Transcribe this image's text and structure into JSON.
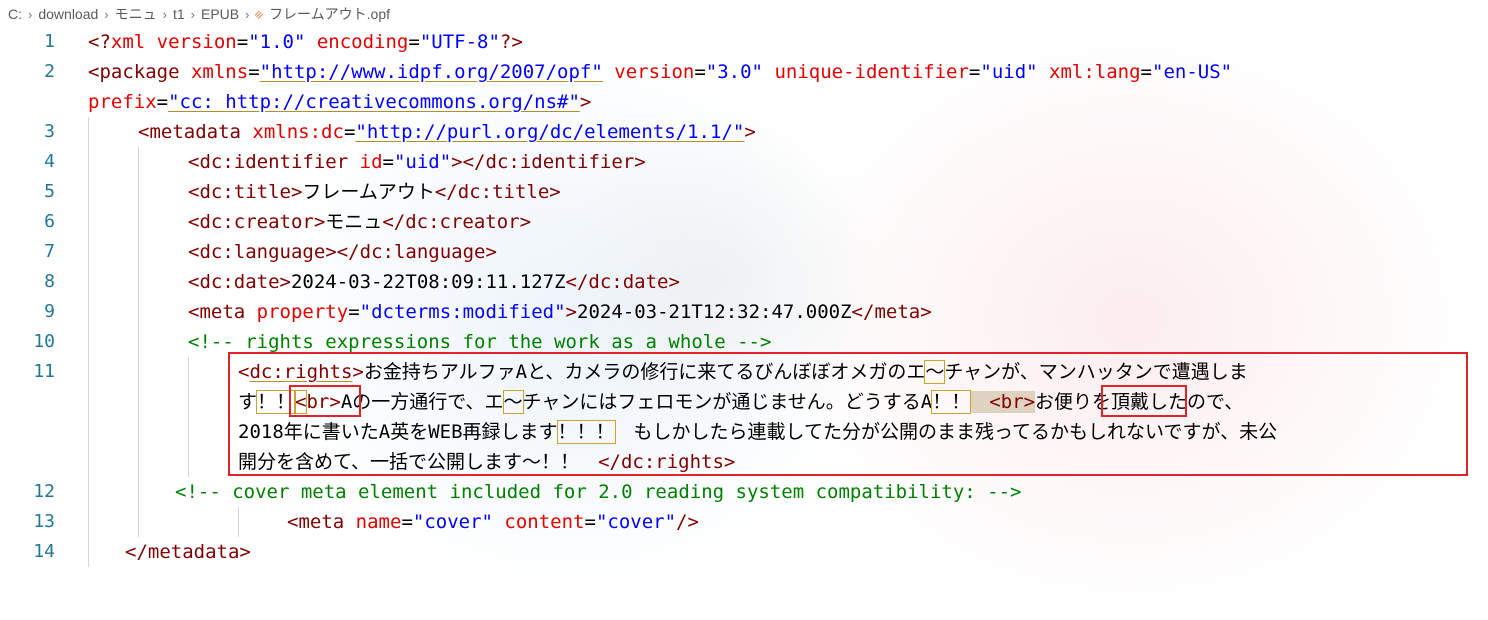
{
  "breadcrumb": {
    "items": [
      "C:",
      "download",
      "モニュ",
      "t1",
      "EPUB"
    ],
    "file": "フレームアウト.opf"
  },
  "lines": [
    {
      "n": "1"
    },
    {
      "n": "2"
    },
    {
      "n": "3"
    },
    {
      "n": "4"
    },
    {
      "n": "5"
    },
    {
      "n": "6"
    },
    {
      "n": "7"
    },
    {
      "n": "8"
    },
    {
      "n": "9"
    },
    {
      "n": "10"
    },
    {
      "n": "11"
    },
    {
      "n": "12"
    },
    {
      "n": "13"
    },
    {
      "n": "14"
    }
  ],
  "code": {
    "l1": {
      "q": "<?",
      "xml": "xml",
      "a1": "version",
      "v1": "\"1.0\"",
      "a2": "encoding",
      "v2": "\"UTF-8\"",
      "end": "?>"
    },
    "l2": {
      "tag": "package",
      "a1": "xmlns",
      "v1": "\"http://www.idpf.org/2007/opf\"",
      "a2": "version",
      "v2": "\"3.0\"",
      "a3": "unique-identifier",
      "v3": "\"uid\"",
      "a4": "xml:lang",
      "v4": "\"en-US\""
    },
    "l2b": {
      "a": "prefix",
      "v": "\"cc: http://creativecommons.org/ns#\""
    },
    "l3": {
      "tag": "metadata",
      "a": "xmlns:dc",
      "v": "\"http://purl.org/dc/elements/1.1/\""
    },
    "l4": {
      "tag": "dc:identifier",
      "a": "id",
      "v": "\"uid\""
    },
    "l5": {
      "tag": "dc:title",
      "text": "フレームアウト"
    },
    "l6": {
      "tag": "dc:creator",
      "text": "モニュ"
    },
    "l7": {
      "tag": "dc:language"
    },
    "l8": {
      "tag": "dc:date",
      "text": "2024-03-22T08:09:11.127Z"
    },
    "l9": {
      "tag": "meta",
      "a": "property",
      "v": "\"dcterms:modified\"",
      "text": "2024-03-21T12:32:47.000Z"
    },
    "l10": {
      "comment": "<!-- rights expressions for the work as a whole -->"
    },
    "l11": {
      "tag": "dc:rights",
      "t1": "お金持ちアルファAと、カメラの修行に来てるびんぼぼオメガのエ",
      "tilde": "～",
      "t2": "チャンが、マンハッタンで遭遇しま",
      "t3": "す",
      "ex": "！！",
      "br": "br",
      "t4": "Aの一方通行で、エ",
      "t5": "チャンにはフェロモンが通じません。どうするA",
      "t6": "お便りを頂戴したので、",
      "t7": "2018年に書いたA英をWEB再録します",
      "ex3": "！！！",
      "t8": "　もしかしたら連載してた分が公開のまま残ってるかもしれないですが、未公",
      "t9": "開分を含めて、一括で公開します～！！　"
    },
    "l12": {
      "comment": "<!-- cover meta element included for 2.0 reading system compatibility: -->"
    },
    "l13": {
      "tag": "meta",
      "a1": "name",
      "v1": "\"cover\"",
      "a2": "content",
      "v2": "\"cover\""
    },
    "l14": {
      "tag": "metadata"
    }
  },
  "colors": {
    "tag": "#800000",
    "attr": "#e50000",
    "value": "#0000ff",
    "comment": "#008000",
    "linenumber": "#237893",
    "selection": "#e0242a"
  }
}
